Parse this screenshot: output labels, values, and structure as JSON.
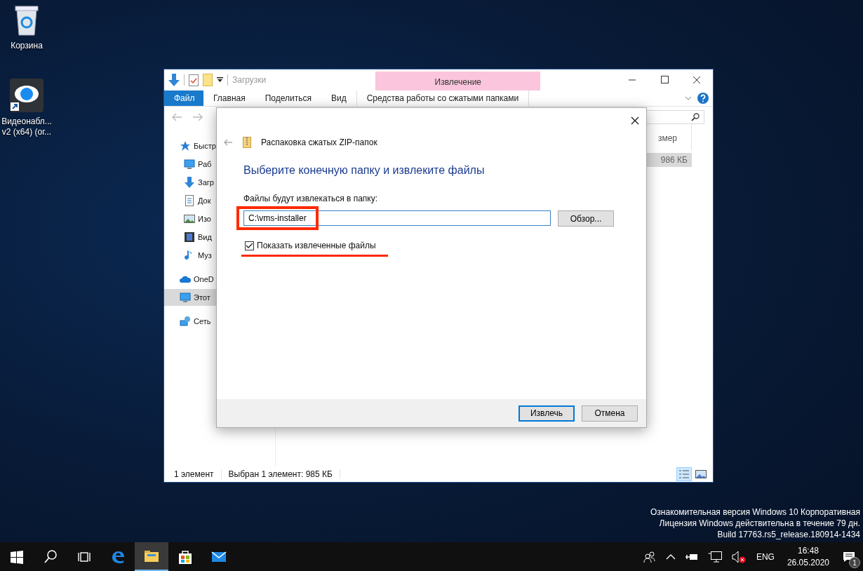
{
  "desktop_icons": [
    {
      "kind": "recycle",
      "label": "Корзина"
    },
    {
      "kind": "eye",
      "label": "Видеонабл...\nv2 (x64) (ог..."
    }
  ],
  "explorer": {
    "title": "Загрузки",
    "context_group": "Извлечение",
    "ribbon_tabs": [
      {
        "label": "Файл",
        "kind": "file"
      },
      {
        "label": "Главная",
        "kind": "tab"
      },
      {
        "label": "Поделиться",
        "kind": "tab"
      },
      {
        "label": "Вид",
        "kind": "tab"
      },
      {
        "label": "Средства работы со сжатыми папками",
        "kind": "context"
      }
    ],
    "nav_items": [
      {
        "kind": "star",
        "label": "Быстр",
        "selected": false
      },
      {
        "kind": "desktop",
        "label": "Раб",
        "selected": false
      },
      {
        "kind": "download",
        "label": "Загр",
        "selected": false
      },
      {
        "kind": "doc",
        "label": "Док",
        "selected": false
      },
      {
        "kind": "image",
        "label": "Изо",
        "selected": false
      },
      {
        "kind": "video",
        "label": "Вид",
        "selected": false
      },
      {
        "kind": "music",
        "label": "Муз",
        "selected": false
      },
      {
        "kind": "cloud",
        "label": "OneD",
        "selected": false
      },
      {
        "kind": "pc",
        "label": "Этот",
        "selected": true
      },
      {
        "kind": "net",
        "label": "Сеть",
        "selected": false
      }
    ],
    "column_header": "змер",
    "file_size": "986 КБ",
    "status_items": [
      "1 элемент",
      "Выбран 1 элемент: 985 КБ"
    ],
    "view_buttons": [
      {
        "kind": "details",
        "selected": true
      },
      {
        "kind": "large",
        "selected": false
      }
    ]
  },
  "dialog": {
    "title": "Распаковка сжатых ZIP-папок",
    "heading": "Выберите конечную папку и извлеките файлы",
    "field_label": "Файлы будут извлекаться в папку:",
    "path_value": "C:\\vms-installer",
    "browse_button": "Обзор...",
    "checkbox": {
      "label": "Показать извлеченные файлы",
      "checked": true
    },
    "buttons": [
      {
        "label": "Извлечь",
        "default": true
      },
      {
        "label": "Отмена",
        "default": false
      }
    ]
  },
  "watermark_lines": [
    "Ознакомительная версия Windows 10 Корпоративная",
    "Лицензия Windows действительна в течение 79 дн.",
    "Build 17763.rs5_release.180914-1434"
  ],
  "taskbar": {
    "apps": [
      {
        "kind": "start",
        "selected": false
      },
      {
        "kind": "search",
        "selected": false
      },
      {
        "kind": "taskview",
        "selected": false
      },
      {
        "kind": "edge",
        "selected": false
      },
      {
        "kind": "explorer",
        "selected": true
      },
      {
        "kind": "store",
        "selected": false
      },
      {
        "kind": "mail",
        "selected": false
      }
    ],
    "language": "ENG",
    "time": "16:48",
    "date": "26.05.2020",
    "notification_count": "1"
  }
}
